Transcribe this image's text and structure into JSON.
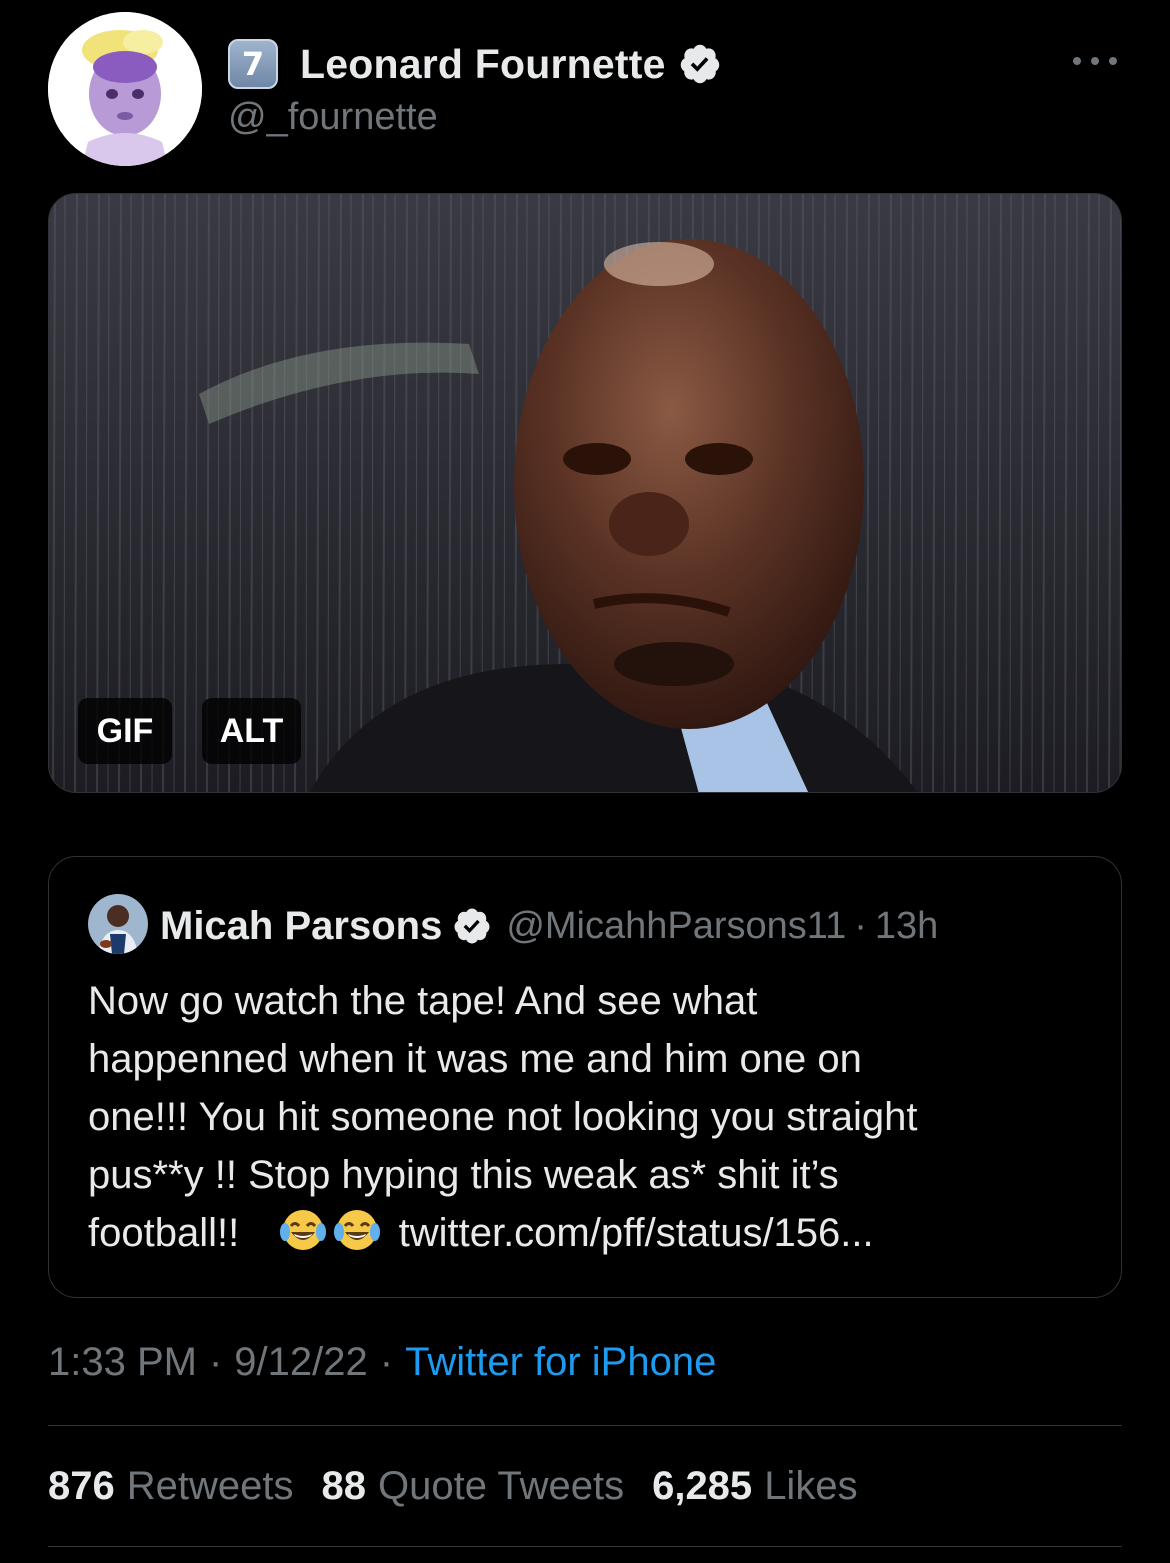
{
  "author": {
    "emoji_badge": "7",
    "name": "Leonard Fournette",
    "handle": "@_fournette",
    "verified": true,
    "avatar": "baby-portrait-avatar"
  },
  "media": {
    "badges": {
      "gif": "GIF",
      "alt": "ALT"
    },
    "image": "crying-man-in-rain-gif"
  },
  "quote": {
    "name": "Micah Parsons",
    "handle": "@MicahhParsons11",
    "time": "13h",
    "dot": "·",
    "lines": [
      "Now go watch the tape! And see what",
      "happenned when it was  me and him one on",
      "one!!! You hit someone not looking you straight",
      "pus**y !! Stop hyping this weak as* shit it’s"
    ],
    "last_line_prefix": "football!!",
    "link": "twitter.com/pff/status/156...",
    "emoji_name": "face-with-tears-of-joy"
  },
  "meta": {
    "time": "1:33 PM",
    "date": "9/12/22",
    "sep": "·",
    "source": "Twitter for iPhone"
  },
  "stats": {
    "retweets": {
      "count": "876",
      "label": "Retweets"
    },
    "quotes": {
      "count": "88",
      "label": "Quote Tweets"
    },
    "likes": {
      "count": "6,285",
      "label": "Likes"
    }
  },
  "colors": {
    "background": "#000000",
    "text": "#e7e9ea",
    "muted": "#71767b",
    "link": "#1d9bf0",
    "border": "#2f3336"
  }
}
